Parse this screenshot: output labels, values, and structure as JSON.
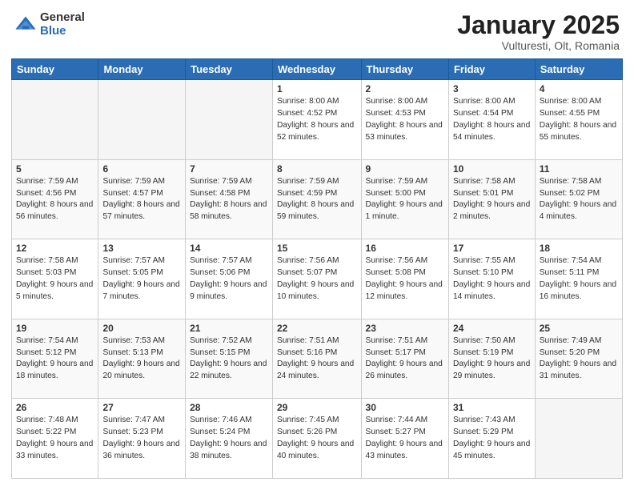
{
  "header": {
    "logo": {
      "general": "General",
      "blue": "Blue"
    },
    "title": "January 2025",
    "location": "Vulturesti, Olt, Romania"
  },
  "weekdays": [
    "Sunday",
    "Monday",
    "Tuesday",
    "Wednesday",
    "Thursday",
    "Friday",
    "Saturday"
  ],
  "weeks": [
    [
      {
        "day": "",
        "empty": true
      },
      {
        "day": "",
        "empty": true
      },
      {
        "day": "",
        "empty": true
      },
      {
        "day": "1",
        "sunrise": "8:00 AM",
        "sunset": "4:52 PM",
        "daylight": "8 hours and 52 minutes."
      },
      {
        "day": "2",
        "sunrise": "8:00 AM",
        "sunset": "4:53 PM",
        "daylight": "8 hours and 53 minutes."
      },
      {
        "day": "3",
        "sunrise": "8:00 AM",
        "sunset": "4:54 PM",
        "daylight": "8 hours and 54 minutes."
      },
      {
        "day": "4",
        "sunrise": "8:00 AM",
        "sunset": "4:55 PM",
        "daylight": "8 hours and 55 minutes."
      }
    ],
    [
      {
        "day": "5",
        "sunrise": "7:59 AM",
        "sunset": "4:56 PM",
        "daylight": "8 hours and 56 minutes."
      },
      {
        "day": "6",
        "sunrise": "7:59 AM",
        "sunset": "4:57 PM",
        "daylight": "8 hours and 57 minutes."
      },
      {
        "day": "7",
        "sunrise": "7:59 AM",
        "sunset": "4:58 PM",
        "daylight": "8 hours and 58 minutes."
      },
      {
        "day": "8",
        "sunrise": "7:59 AM",
        "sunset": "4:59 PM",
        "daylight": "8 hours and 59 minutes."
      },
      {
        "day": "9",
        "sunrise": "7:59 AM",
        "sunset": "5:00 PM",
        "daylight": "9 hours and 1 minute."
      },
      {
        "day": "10",
        "sunrise": "7:58 AM",
        "sunset": "5:01 PM",
        "daylight": "9 hours and 2 minutes."
      },
      {
        "day": "11",
        "sunrise": "7:58 AM",
        "sunset": "5:02 PM",
        "daylight": "9 hours and 4 minutes."
      }
    ],
    [
      {
        "day": "12",
        "sunrise": "7:58 AM",
        "sunset": "5:03 PM",
        "daylight": "9 hours and 5 minutes."
      },
      {
        "day": "13",
        "sunrise": "7:57 AM",
        "sunset": "5:05 PM",
        "daylight": "9 hours and 7 minutes."
      },
      {
        "day": "14",
        "sunrise": "7:57 AM",
        "sunset": "5:06 PM",
        "daylight": "9 hours and 9 minutes."
      },
      {
        "day": "15",
        "sunrise": "7:56 AM",
        "sunset": "5:07 PM",
        "daylight": "9 hours and 10 minutes."
      },
      {
        "day": "16",
        "sunrise": "7:56 AM",
        "sunset": "5:08 PM",
        "daylight": "9 hours and 12 minutes."
      },
      {
        "day": "17",
        "sunrise": "7:55 AM",
        "sunset": "5:10 PM",
        "daylight": "9 hours and 14 minutes."
      },
      {
        "day": "18",
        "sunrise": "7:54 AM",
        "sunset": "5:11 PM",
        "daylight": "9 hours and 16 minutes."
      }
    ],
    [
      {
        "day": "19",
        "sunrise": "7:54 AM",
        "sunset": "5:12 PM",
        "daylight": "9 hours and 18 minutes."
      },
      {
        "day": "20",
        "sunrise": "7:53 AM",
        "sunset": "5:13 PM",
        "daylight": "9 hours and 20 minutes."
      },
      {
        "day": "21",
        "sunrise": "7:52 AM",
        "sunset": "5:15 PM",
        "daylight": "9 hours and 22 minutes."
      },
      {
        "day": "22",
        "sunrise": "7:51 AM",
        "sunset": "5:16 PM",
        "daylight": "9 hours and 24 minutes."
      },
      {
        "day": "23",
        "sunrise": "7:51 AM",
        "sunset": "5:17 PM",
        "daylight": "9 hours and 26 minutes."
      },
      {
        "day": "24",
        "sunrise": "7:50 AM",
        "sunset": "5:19 PM",
        "daylight": "9 hours and 29 minutes."
      },
      {
        "day": "25",
        "sunrise": "7:49 AM",
        "sunset": "5:20 PM",
        "daylight": "9 hours and 31 minutes."
      }
    ],
    [
      {
        "day": "26",
        "sunrise": "7:48 AM",
        "sunset": "5:22 PM",
        "daylight": "9 hours and 33 minutes."
      },
      {
        "day": "27",
        "sunrise": "7:47 AM",
        "sunset": "5:23 PM",
        "daylight": "9 hours and 36 minutes."
      },
      {
        "day": "28",
        "sunrise": "7:46 AM",
        "sunset": "5:24 PM",
        "daylight": "9 hours and 38 minutes."
      },
      {
        "day": "29",
        "sunrise": "7:45 AM",
        "sunset": "5:26 PM",
        "daylight": "9 hours and 40 minutes."
      },
      {
        "day": "30",
        "sunrise": "7:44 AM",
        "sunset": "5:27 PM",
        "daylight": "9 hours and 43 minutes."
      },
      {
        "day": "31",
        "sunrise": "7:43 AM",
        "sunset": "5:29 PM",
        "daylight": "9 hours and 45 minutes."
      },
      {
        "day": "",
        "empty": true
      }
    ]
  ]
}
